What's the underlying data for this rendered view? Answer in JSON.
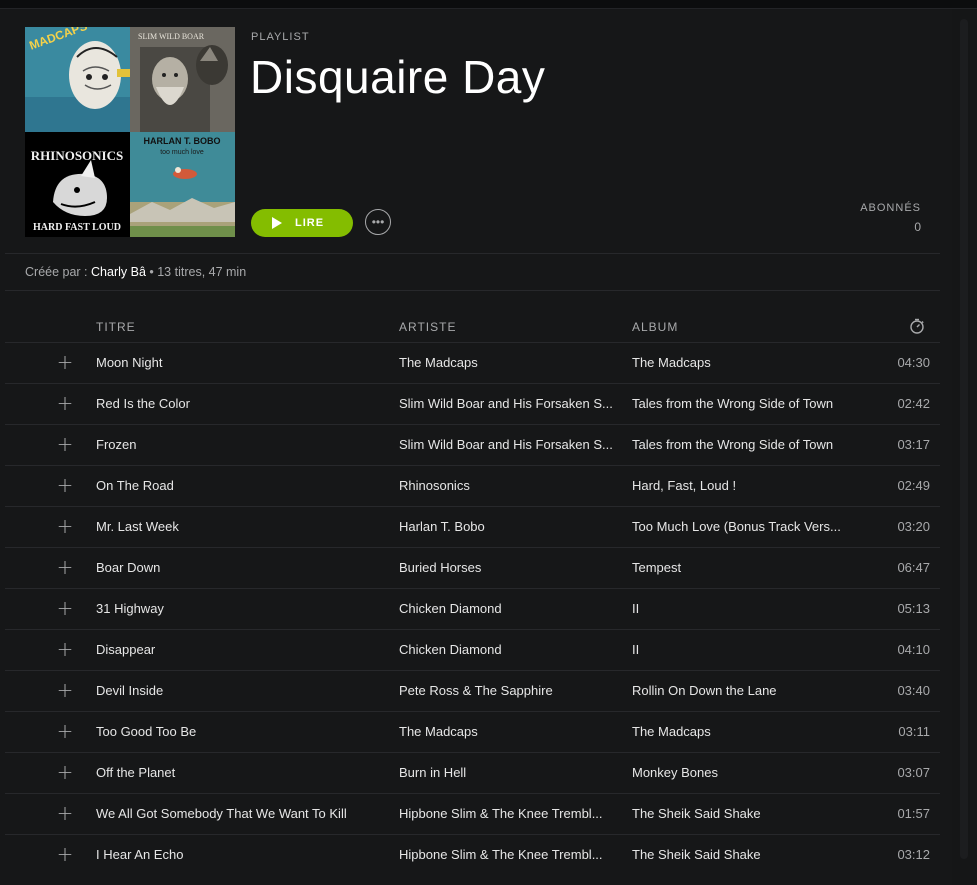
{
  "header": {
    "type_label": "PLAYLIST",
    "title": "Disquaire Day",
    "play_label": "LIRE",
    "more_label": "•••",
    "followers_label": "ABONNÉS",
    "followers_count": "0"
  },
  "cover": {
    "tiles": [
      {
        "name": "the-madcaps-cover",
        "bg": "#3a8aa0",
        "text": "MADCAPS"
      },
      {
        "name": "slim-wild-boar-cover",
        "bg": "#6a6760",
        "text": "SLIM WILD BOAR"
      },
      {
        "name": "rhinosonics-cover",
        "bg": "#000000",
        "text_top": "RHINOSONICS",
        "text_bottom": "HARD FAST LOUD"
      },
      {
        "name": "harlan-t-bobo-cover",
        "bg": "#3f8b98",
        "text_top": "HARLAN T. BOBO",
        "text_bottom": "too much love"
      }
    ]
  },
  "meta": {
    "created_by_label": "Créée par : ",
    "owner": "Charly Bâ",
    "summary": " • 13 titres, 47 min"
  },
  "table": {
    "columns": {
      "title": "TITRE",
      "artist": "ARTISTE",
      "album": "ALBUM"
    },
    "rows": [
      {
        "title": "Moon Night",
        "artist": "The Madcaps",
        "album": "The Madcaps",
        "duration": "04:30"
      },
      {
        "title": "Red Is the Color",
        "artist": "Slim Wild Boar and His Forsaken S...",
        "album": "Tales from the Wrong Side of Town",
        "duration": "02:42"
      },
      {
        "title": "Frozen",
        "artist": "Slim Wild Boar and His Forsaken S...",
        "album": "Tales from the Wrong Side of Town",
        "duration": "03:17"
      },
      {
        "title": "On The Road",
        "artist": "Rhinosonics",
        "album": "Hard, Fast, Loud !",
        "duration": "02:49"
      },
      {
        "title": "Mr. Last Week",
        "artist": "Harlan T. Bobo",
        "album": "Too Much Love (Bonus Track Vers...",
        "duration": "03:20"
      },
      {
        "title": "Boar Down",
        "artist": "Buried Horses",
        "album": "Tempest",
        "duration": "06:47"
      },
      {
        "title": "31 Highway",
        "artist": "Chicken Diamond",
        "album": "II",
        "duration": "05:13"
      },
      {
        "title": "Disappear",
        "artist": "Chicken Diamond",
        "album": "II",
        "duration": "04:10"
      },
      {
        "title": "Devil Inside",
        "artist": "Pete Ross & The Sapphire",
        "album": "Rollin On Down the Lane",
        "duration": "03:40"
      },
      {
        "title": "Too Good Too Be",
        "artist": "The Madcaps",
        "album": "The Madcaps",
        "duration": "03:11"
      },
      {
        "title": "Off the Planet",
        "artist": "Burn in Hell",
        "album": "Monkey Bones",
        "duration": "03:07"
      },
      {
        "title": "We All Got Somebody That We Want To Kill",
        "artist": "Hipbone Slim & The Knee Trembl...",
        "album": "The Sheik Said Shake",
        "duration": "01:57"
      },
      {
        "title": "I Hear An Echo",
        "artist": "Hipbone Slim & The Knee Trembl...",
        "album": "The Sheik Said Shake",
        "duration": "03:12"
      }
    ]
  },
  "colors": {
    "accent": "#84bd00",
    "background": "#161718",
    "muted_text": "#a8a9ab"
  }
}
